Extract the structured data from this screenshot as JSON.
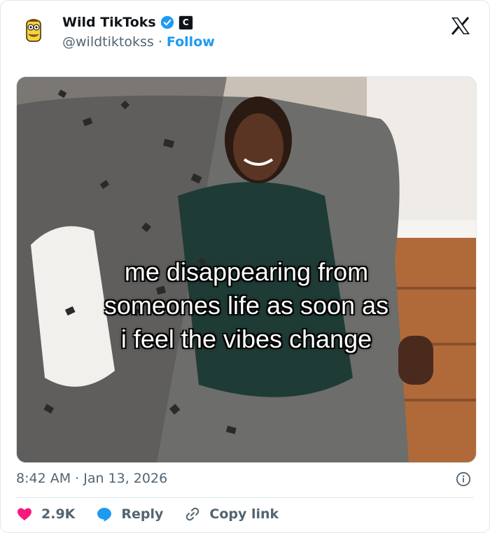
{
  "header": {
    "display_name": "Wild TikToks",
    "handle": "@wildtiktokss",
    "separator": "·",
    "follow_label": "Follow",
    "affiliation_badge": "C",
    "avatar_icon": "cartoon-character-icon",
    "brand_icon": "x-logo-icon",
    "verified_color": "#1d9bf0"
  },
  "media": {
    "caption": "me disappearing from\nsomeones life as soon as\ni feel the vibes change"
  },
  "meta": {
    "timestamp": "8:42 AM · Jan 13, 2026",
    "info_icon": "info-icon"
  },
  "actions": {
    "like_count": "2.9K",
    "reply_label": "Reply",
    "copy_label": "Copy link",
    "like_color": "#f91880",
    "reply_color": "#1d9bf0"
  }
}
